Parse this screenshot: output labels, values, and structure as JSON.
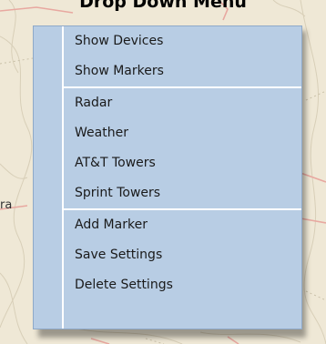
{
  "page": {
    "title": "Drop Down Menu",
    "map_edge_label": "ra"
  },
  "menu": {
    "groups": [
      {
        "items": [
          {
            "label": "Show Devices"
          },
          {
            "label": "Show Markers"
          }
        ]
      },
      {
        "items": [
          {
            "label": "Radar"
          },
          {
            "label": "Weather"
          },
          {
            "label": "AT&T Towers"
          },
          {
            "label": "Sprint Towers"
          }
        ]
      },
      {
        "items": [
          {
            "label": "Add Marker"
          },
          {
            "label": "Save Settings"
          },
          {
            "label": "Delete Settings"
          }
        ]
      }
    ]
  },
  "colors": {
    "menu_background": "#b8cde4",
    "menu_separator": "#ffffff",
    "map_background": "#efe8d6"
  }
}
